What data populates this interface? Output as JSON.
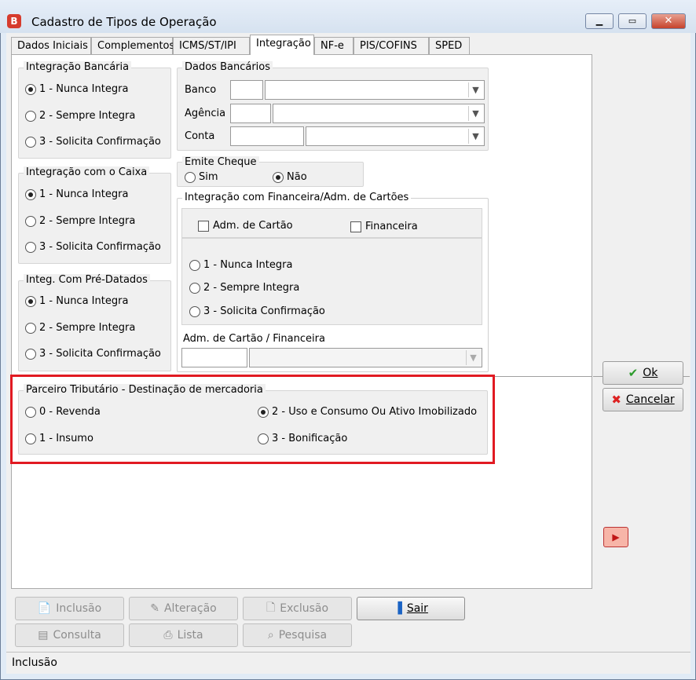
{
  "window": {
    "title": "Cadastro de Tipos de Operação",
    "app_icon": "B",
    "min": "▭",
    "max": "□",
    "close": "✕"
  },
  "tabs": [
    "Dados Iniciais",
    "Complementos",
    "ICMS/ST/IPI",
    "Integração",
    "NF-e",
    "PIS/COFINS",
    "SPED"
  ],
  "active_tab": "Integração",
  "integracao_bancaria": {
    "legend": "Integração Bancária",
    "options": [
      "1 - Nunca Integra",
      "2 - Sempre Integra",
      "3 - Solicita Confirmação"
    ],
    "selected": 0
  },
  "integracao_caixa": {
    "legend": "Integração com o Caixa",
    "options": [
      "1 - Nunca Integra",
      "2 - Sempre Integra",
      "3 - Solicita Confirmação"
    ],
    "selected": 0
  },
  "integ_pre_datados": {
    "legend": "Integ. Com Pré-Datados",
    "options": [
      "1 - Nunca Integra",
      "2 - Sempre Integra",
      "3 - Solicita Confirmação"
    ],
    "selected": 0
  },
  "dados_bancarios": {
    "legend": "Dados Bancários",
    "banco": "Banco",
    "agencia": "Agência",
    "conta": "Conta"
  },
  "emite_cheque": {
    "legend": "Emite Cheque",
    "sim": "Sim",
    "nao": "Não",
    "selected": "nao"
  },
  "financeira": {
    "legend": "Integração com Financeira/Adm. de Cartões",
    "adm_cartao": "Adm. de Cartão",
    "financeira": "Financeira",
    "options": [
      "1 - Nunca Integra",
      "2 - Sempre Integra",
      "3 - Solicita Confirmação"
    ],
    "adm_label": "Adm. de Cartão / Financeira"
  },
  "parceiro": {
    "legend": "Parceiro Tributário - Destinação de mercadoria",
    "options": [
      "0 - Revenda",
      "1 - Insumo",
      "2 - Uso e Consumo Ou Ativo Imobilizado",
      "3 - Bonificação"
    ],
    "selected": 2
  },
  "side_buttons": {
    "ok": "Ok",
    "cancelar": "Cancelar"
  },
  "bottom_buttons": {
    "inclusao": "Inclusão",
    "alteracao": "Alteração",
    "exclusao": "Exclusão",
    "sair": "Sair",
    "consulta": "Consulta",
    "lista": "Lista",
    "pesquisa": "Pesquisa"
  },
  "status": "Inclusão"
}
